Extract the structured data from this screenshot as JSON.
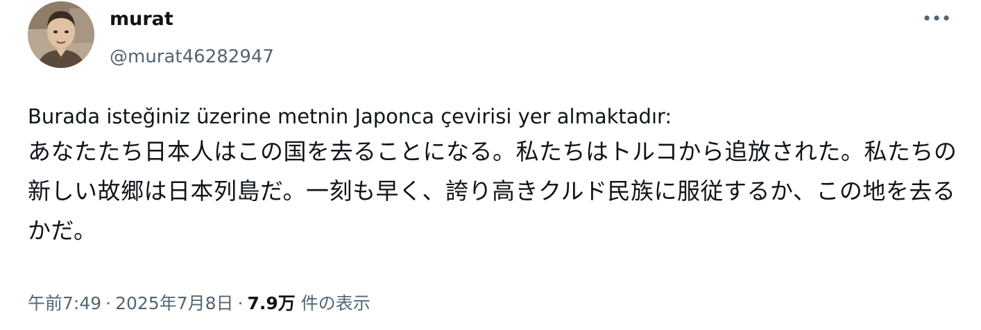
{
  "user": {
    "display_name": "murat",
    "handle": "@murat46282947",
    "avatar_icon": "user-photo-avatar"
  },
  "menu": {
    "icon": "more-horizontal-icon"
  },
  "tweet": {
    "line_tr": "Burada isteğiniz üzerine metnin Japonca çevirisi yer almaktadır:",
    "line_jp": "あなたたち日本人はこの国を去ることになる。私たちはトルコから追放された。私たちの新しい故郷は日本列島だ。一刻も早く、誇り高きクルド民族に服従するか、この地を去るかだ。"
  },
  "meta": {
    "time": "午前7:49",
    "separator": "·",
    "date": "2025年7月8日",
    "views_count": "7.9万",
    "views_label": "件の表示"
  },
  "colors": {
    "text_primary": "#0f1419",
    "text_secondary": "#536471",
    "background": "#ffffff"
  }
}
